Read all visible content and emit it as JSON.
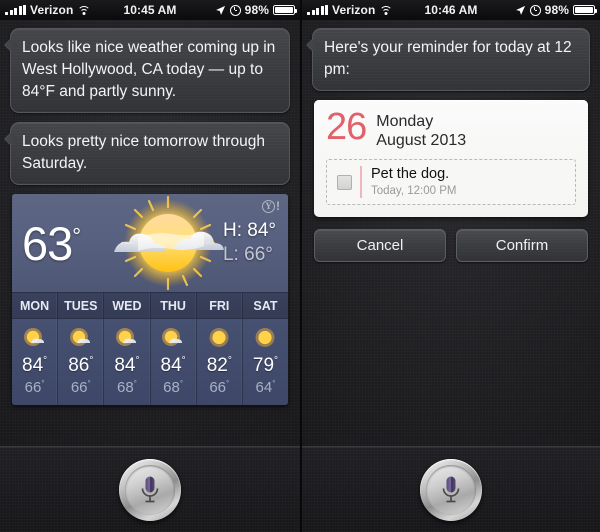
{
  "screens": [
    {
      "id": "siri-weather",
      "status_bar": {
        "signal_icon": "signal-bars-icon",
        "carrier": "Verizon",
        "wifi_icon": "wifi-icon",
        "time": "10:45 AM",
        "location_icon": "location-arrow-icon",
        "alarm_icon": "alarm-clock-icon",
        "battery_percent": "98%",
        "battery_icon": "battery-icon"
      },
      "bubbles": [
        "Looks like nice weather coming up in West Hollywood, CA today — up to 84°F and partly sunny.",
        "Looks pretty nice tomorrow through Saturday."
      ],
      "weather": {
        "provider_logo": "yahoo-logo",
        "provider_mark": "Y",
        "provider_bang": "!",
        "current_temp": "63",
        "degree": "°",
        "condition_icon": "sun-behind-cloud-icon",
        "high_label": "H:",
        "high_value": "84°",
        "low_label": "L:",
        "low_value": "66°",
        "forecast": [
          {
            "day": "MON",
            "icon": "sun-behind-cloud-icon",
            "high": "84",
            "low": "66"
          },
          {
            "day": "TUES",
            "icon": "sun-behind-cloud-icon",
            "high": "86",
            "low": "66"
          },
          {
            "day": "WED",
            "icon": "sun-behind-cloud-icon",
            "high": "84",
            "low": "68"
          },
          {
            "day": "THU",
            "icon": "sun-behind-cloud-icon",
            "high": "84",
            "low": "68"
          },
          {
            "day": "FRI",
            "icon": "sun-icon",
            "high": "82",
            "low": "66"
          },
          {
            "day": "SAT",
            "icon": "sun-icon",
            "high": "79",
            "low": "64"
          }
        ]
      },
      "mic_button": {
        "icon": "siri-microphone-icon"
      }
    },
    {
      "id": "siri-reminder",
      "status_bar": {
        "signal_icon": "signal-bars-icon",
        "carrier": "Verizon",
        "wifi_icon": "wifi-icon",
        "time": "10:46 AM",
        "location_icon": "location-arrow-icon",
        "alarm_icon": "alarm-clock-icon",
        "battery_percent": "98%",
        "battery_icon": "battery-icon"
      },
      "bubbles": [
        "Here's your reminder for today at 12 pm:"
      ],
      "reminder": {
        "day_number": "26",
        "weekday": "Monday",
        "month_year": "August 2013",
        "checkbox_icon": "checkbox-unchecked-icon",
        "item_title": "Pet the dog.",
        "item_subtitle": "Today, 12:00 PM"
      },
      "actions": [
        {
          "name": "cancel-button",
          "label": "Cancel"
        },
        {
          "name": "confirm-button",
          "label": "Confirm"
        }
      ],
      "mic_button": {
        "icon": "siri-microphone-icon"
      }
    }
  ],
  "colors": {
    "bubble_bg": "#3a3c40",
    "weather_bg": "#5d6683",
    "reminder_accent": "#e2606a",
    "card_bg": "#f7f7f5",
    "status_text": "#f2f2f2"
  }
}
